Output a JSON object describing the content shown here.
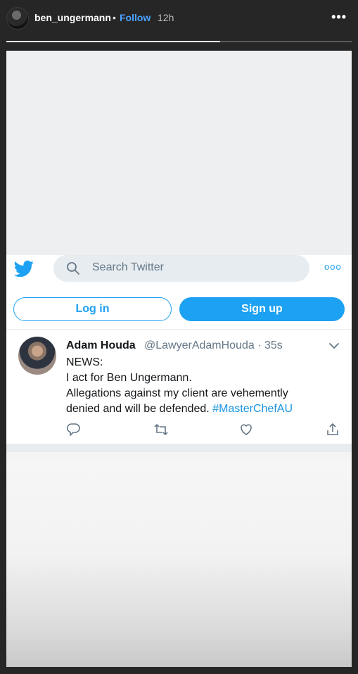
{
  "story": {
    "username": "ben_ungermann",
    "separator": "•",
    "follow_label": "Follow",
    "time": "12h",
    "more_label": "•••",
    "progress": 0.62,
    "colors": {
      "follow": "#4aa3ff",
      "background": "#262626"
    }
  },
  "twitter": {
    "search_placeholder": "Search Twitter",
    "more_label": "ooo",
    "login_label": "Log in",
    "signup_label": "Sign up",
    "accent": "#1da1f2",
    "tweet": {
      "author_name": "Adam Houda",
      "author_handle": "@LawyerAdamHouda · 35s",
      "lines": [
        "NEWS:",
        "I act for Ben Ungermann.",
        "Allegations against my client are vehemently",
        "denied and will be defended."
      ],
      "hashtag": "#MasterChefAU"
    },
    "icons": [
      "twitter-bird-icon",
      "search-icon",
      "chevron-down-icon",
      "reply-icon",
      "retweet-icon",
      "like-icon",
      "share-icon"
    ]
  }
}
